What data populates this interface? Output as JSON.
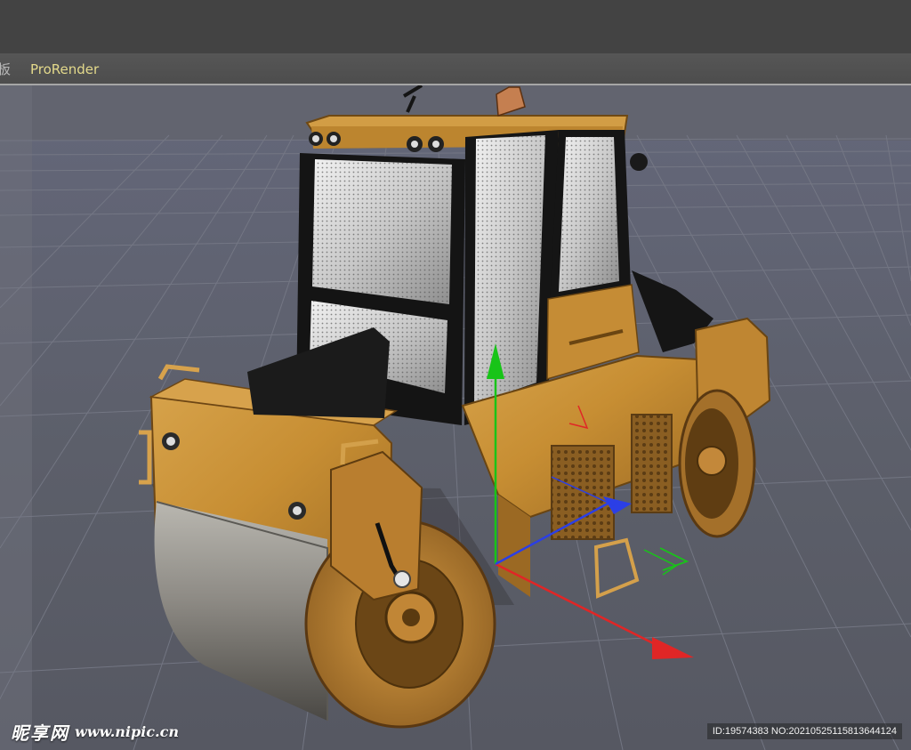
{
  "menu": {
    "partial_label": "板",
    "prorender_label": "ProRender"
  },
  "watermark": {
    "site_name": "昵享网",
    "url": "www.nipic.cn",
    "id_text": "ID:19574383 NO:20210525115813644124"
  },
  "colors": {
    "viewport_background": "#595c66",
    "grid_line": "#6e717c",
    "machine_body": "#c88e34",
    "axis_x": "#e02626",
    "axis_y": "#18c418",
    "axis_z": "#2b3fe6"
  },
  "icons": {
    "camera_axis_glyph": "axis-cube-icon"
  }
}
